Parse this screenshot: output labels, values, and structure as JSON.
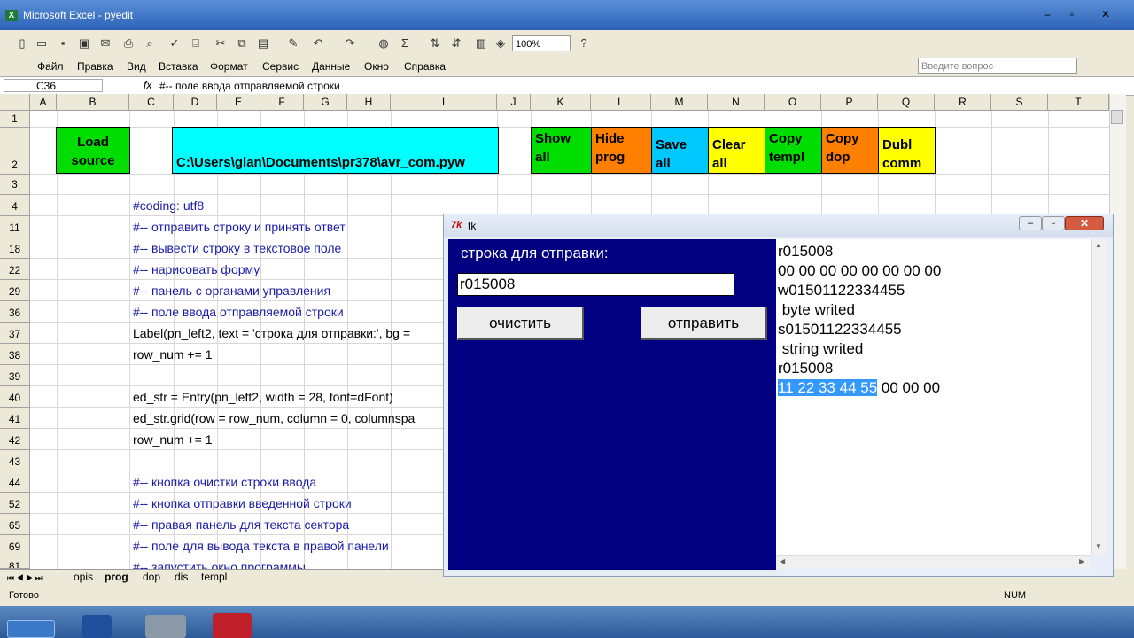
{
  "window": {
    "title": "Microsoft Excel - pyedit"
  },
  "toolbar": {
    "zoom": "100%"
  },
  "menu": [
    "Файл",
    "Правка",
    "Вид",
    "Вставка",
    "Формат",
    "Сервис",
    "Данные",
    "Окно",
    "Справка"
  ],
  "ask_placeholder": "Введите вопрос",
  "formula": {
    "cell_ref": "C36",
    "fx": "fx",
    "content": "#-- поле ввода отправляемой строки"
  },
  "columns": [
    "A",
    "B",
    "C",
    "D",
    "E",
    "F",
    "G",
    "H",
    "I",
    "J",
    "K",
    "L",
    "M",
    "N",
    "O",
    "P",
    "Q",
    "R",
    "S",
    "T"
  ],
  "rows": [
    "1",
    "2",
    "3",
    "4",
    "11",
    "18",
    "22",
    "29",
    "36",
    "37",
    "38",
    "39",
    "40",
    "41",
    "42",
    "43",
    "44",
    "52",
    "65",
    "69",
    "81"
  ],
  "cells": {
    "r4": "#coding: utf8",
    "r11": "#-- отправить строку и принять ответ",
    "r18": "#-- вывести строку в текстовое поле",
    "r22": "#-- нарисовать форму",
    "r29": "#-- панель с органами управления",
    "r36": "#-- поле ввода отправляемой строки",
    "r37": "Label(pn_left2, text = 'строка для отправки:', bg =",
    "r38": "row_num += 1",
    "r40": "ed_str = Entry(pn_left2, width = 28, font=dFont)",
    "r41": "ed_str.grid(row = row_num, column = 0, columnspa",
    "r42": "row_num += 1",
    "r44": "#-- кнопка очистки строки ввода",
    "r52": "#-- кнопка отправки введенной строки",
    "r65": "#-- правая панель для текста сектора",
    "r69": "#-- поле для вывода текста в правой панели",
    "r81": "#-- запустить окно программы"
  },
  "sheet_buttons": {
    "load_source": "Load source",
    "path": "C:\\Users\\glan\\Documents\\pr378\\avr_com.pyw",
    "show_all": "Show all",
    "hide_prog": "Hide prog",
    "save_all": "Save all",
    "clear_all": "Clear all",
    "copy_templ": "Copy templ",
    "copy_dop": "Copy dop",
    "dubl_comm": "Dubl comm"
  },
  "sheet_tabs": [
    "opis",
    "prog",
    "dop",
    "dis",
    "templ"
  ],
  "status": {
    "ready": "Готово",
    "num": "NUM"
  },
  "tk": {
    "title": "tk",
    "label": "строка для отправки:",
    "entry_value": "r015008",
    "clear_button": "очистить",
    "send_button": "отправить",
    "output_lines": [
      "r015008",
      "00 00 00 00 00 00 00 00",
      "w01501122334455",
      " byte writed",
      "s01501122334455",
      " string writed",
      "r015008"
    ],
    "last_line_selected": "11 22 33 44 55",
    "last_line_rest": " 00 00 00"
  },
  "colors": {
    "tk_panel": "#000080",
    "cyan": "#00ffff",
    "green": "#00dd00",
    "orange": "#ff7f00",
    "sky": "#00c8ff",
    "yellow": "#ffff00"
  }
}
